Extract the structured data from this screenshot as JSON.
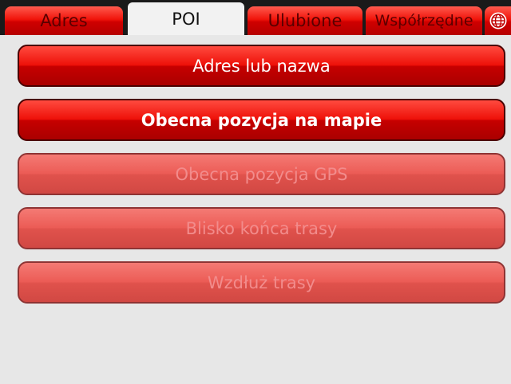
{
  "tabs": [
    {
      "label": "Adres",
      "active": false
    },
    {
      "label": "POI",
      "active": true
    },
    {
      "label": "Ulubione",
      "active": false
    },
    {
      "label": "Współrzędne",
      "active": false
    }
  ],
  "globe_tab": {
    "icon": "globe-icon"
  },
  "buttons": [
    {
      "label": "Adres lub nazwa",
      "enabled": true
    },
    {
      "label": "Obecna pozycja na mapie",
      "enabled": true
    },
    {
      "label": "Obecna pozycja GPS",
      "enabled": false
    },
    {
      "label": "Blisko końca trasy",
      "enabled": false
    },
    {
      "label": "Wzdłuż trasy",
      "enabled": false
    }
  ],
  "colors": {
    "accent_red": "#e3150c",
    "disabled_red": "#ec5c56",
    "background": "#e7e7e7",
    "tabbar": "#1a1a1a"
  }
}
